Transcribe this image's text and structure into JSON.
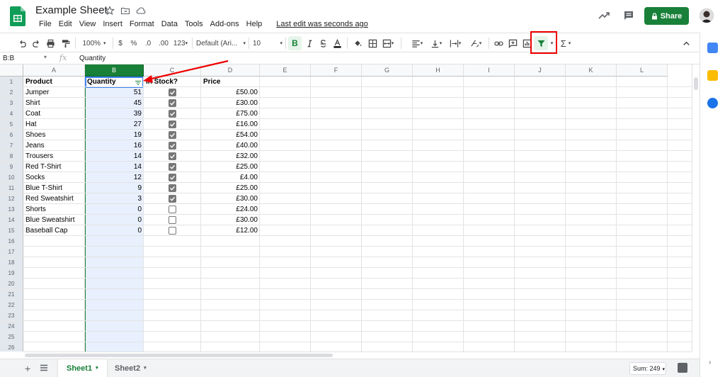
{
  "header": {
    "doc_title": "Example Sheet",
    "menus": [
      "File",
      "Edit",
      "View",
      "Insert",
      "Format",
      "Data",
      "Tools",
      "Add-ons",
      "Help"
    ],
    "last_edit": "Last edit was seconds ago",
    "share_label": "Share",
    "brand_color": "#188038"
  },
  "toolbar": {
    "zoom": "100%",
    "currency": "$",
    "percent": "%",
    "decrease_decimal": ".0",
    "increase_decimal": ".00",
    "more_formats": "123",
    "font": "Default (Ari...",
    "font_size": "10",
    "bold": "B",
    "sigma": "Σ"
  },
  "formula_bar": {
    "name_box": "B:B",
    "fx": "fx",
    "value": "Quantity"
  },
  "grid": {
    "columns": [
      "A",
      "B",
      "C",
      "D",
      "E",
      "F",
      "G",
      "H",
      "I",
      "J",
      "K",
      "L"
    ],
    "selected_column": "B",
    "row_numbers": [
      "1",
      "2",
      "3",
      "4",
      "5",
      "6",
      "7",
      "8",
      "9",
      "10",
      "11",
      "12",
      "13",
      "14",
      "15",
      "16",
      "17",
      "18",
      "19",
      "20",
      "21",
      "22",
      "23",
      "24",
      "25",
      "26"
    ],
    "headers": {
      "product": "Product",
      "quantity": "Quantity",
      "in_stock": "In Stock?",
      "price": "Price"
    },
    "rows": [
      {
        "product": "Jumper",
        "quantity": "51",
        "in_stock": true,
        "price": "£50.00"
      },
      {
        "product": "Shirt",
        "quantity": "45",
        "in_stock": true,
        "price": "£30.00"
      },
      {
        "product": "Coat",
        "quantity": "39",
        "in_stock": true,
        "price": "£75.00"
      },
      {
        "product": "Hat",
        "quantity": "27",
        "in_stock": true,
        "price": "£16.00"
      },
      {
        "product": "Shoes",
        "quantity": "19",
        "in_stock": true,
        "price": "£54.00"
      },
      {
        "product": "Jeans",
        "quantity": "16",
        "in_stock": true,
        "price": "£40.00"
      },
      {
        "product": "Trousers",
        "quantity": "14",
        "in_stock": true,
        "price": "£32.00"
      },
      {
        "product": "Red T-Shirt",
        "quantity": "14",
        "in_stock": true,
        "price": "£25.00"
      },
      {
        "product": "Socks",
        "quantity": "12",
        "in_stock": true,
        "price": "£4.00"
      },
      {
        "product": "Blue T-Shirt",
        "quantity": "9",
        "in_stock": true,
        "price": "£25.00"
      },
      {
        "product": "Red Sweatshirt",
        "quantity": "3",
        "in_stock": true,
        "price": "£30.00"
      },
      {
        "product": "Shorts",
        "quantity": "0",
        "in_stock": false,
        "price": "£24.00"
      },
      {
        "product": "Blue Sweatshirt",
        "quantity": "0",
        "in_stock": false,
        "price": "£30.00"
      },
      {
        "product": "Baseball Cap",
        "quantity": "0",
        "in_stock": false,
        "price": "£12.00"
      }
    ]
  },
  "bottom": {
    "sheets": [
      "Sheet1",
      "Sheet2"
    ],
    "active_sheet": "Sheet1",
    "sum": "Sum: 249"
  },
  "annotations": {
    "highlight_color": "#e00000"
  }
}
